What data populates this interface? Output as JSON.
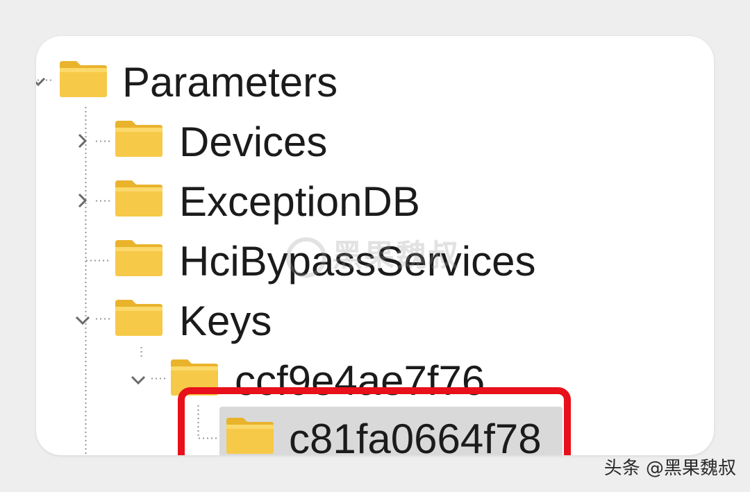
{
  "tree": {
    "nodes": [
      {
        "label": "Parameters",
        "state": "expanded",
        "icon": "folder-icon"
      },
      {
        "label": "Devices",
        "state": "collapsed",
        "icon": "folder-icon"
      },
      {
        "label": "ExceptionDB",
        "state": "collapsed",
        "icon": "folder-icon"
      },
      {
        "label": "HciBypassServices",
        "state": "leaf",
        "icon": "folder-icon"
      },
      {
        "label": "Keys",
        "state": "expanded",
        "icon": "folder-icon"
      },
      {
        "label": "ccf9e4ae7f76",
        "state": "expanded",
        "icon": "folder-icon"
      },
      {
        "label": "c81fa0664f78",
        "state": "selected",
        "icon": "folder-icon"
      }
    ]
  },
  "overlay": {
    "watermark": "黑果魏叔",
    "credit": "头条 @黑果魏叔"
  },
  "colors": {
    "highlight": "#e8101a",
    "folder_fill": "#f7c948",
    "folder_tab": "#e9b32c",
    "selection": "#d9d9d9"
  }
}
